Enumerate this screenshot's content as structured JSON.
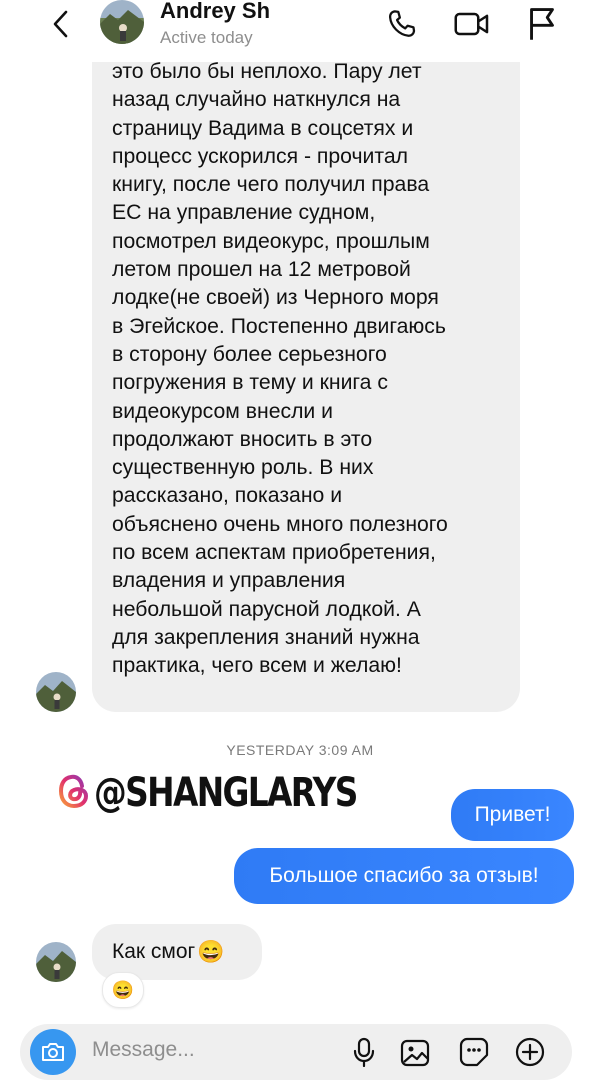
{
  "header": {
    "name": "Andrey Sh",
    "status": "Active today"
  },
  "message_received": {
    "lines": "это было бы неплохо. Пару лет\nназад случайно наткнулся на\nстраницу Вадима в соцсетях и\nпроцесс ускорился - прочитал\nкнигу, после чего получил права\nЕС на управление судном,\nпосмотрел видеокурс, прошлым\nлетом прошел на 12 метровой\nлодке(не своей) из Черного моря\nв Эгейское. Постепенно двигаюсь\nв сторону более серьезного\nпогружения в тему и книга с\nвидеокурсом внесли и\nпродолжают вносить в это\nсущественную роль. В них\nрассказано, показано и\nобъяснено очень много полезного\nпо всем аспектам приобретения,\nвладения и управления\nнебольшой парусной лодкой. А\nдля закрепления знаний нужна\nпрактика, чего всем и желаю!"
  },
  "timestamp": "YESTERDAY 3:09 AM",
  "watermark": "@SHANGLARYS",
  "sent_messages": [
    {
      "text": "Привет!"
    },
    {
      "text": "Большое спасибо за отзыв!"
    }
  ],
  "reply": {
    "text": "Как смог",
    "emoji": "😄",
    "reaction_emoji": "😄"
  },
  "composer": {
    "placeholder": "Message..."
  },
  "colors": {
    "accent": "#3797f0",
    "sent_bubble": "#3a86ff",
    "received_bubble": "#efefef"
  }
}
